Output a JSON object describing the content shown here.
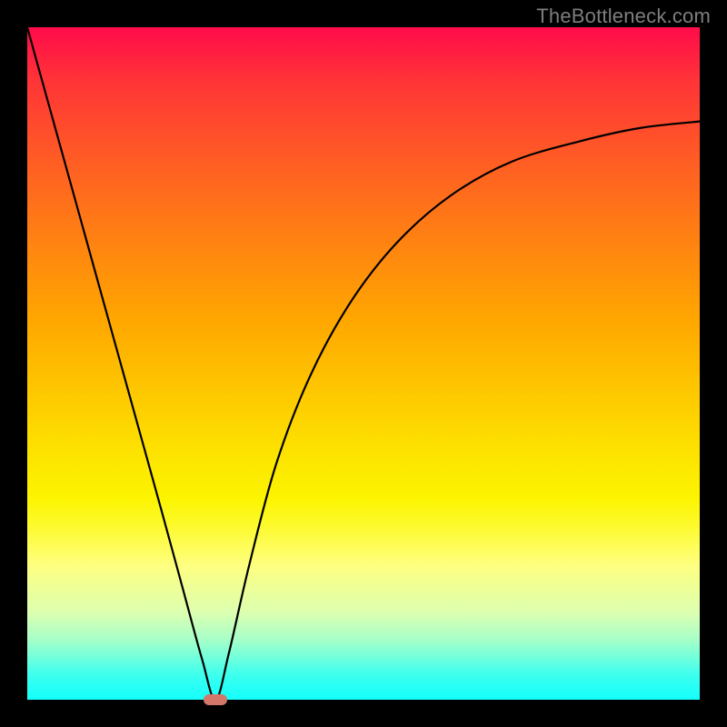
{
  "watermark": "TheBottleneck.com",
  "chart_data": {
    "type": "line",
    "title": "",
    "xlabel": "",
    "ylabel": "",
    "xlim": [
      0,
      1
    ],
    "ylim": [
      0,
      1
    ],
    "grid": false,
    "legend": false,
    "background_gradient": {
      "direction": "vertical",
      "stops": [
        {
          "pos": 0.0,
          "color": "#ff0b4a"
        },
        {
          "pos": 0.5,
          "color": "#ffb400"
        },
        {
          "pos": 0.75,
          "color": "#feff60"
        },
        {
          "pos": 1.0,
          "color": "#15fffb"
        }
      ]
    },
    "series": [
      {
        "name": "bottleneck-curve",
        "color": "#000000",
        "x": [
          0.0,
          0.05,
          0.1,
          0.15,
          0.2,
          0.23,
          0.26,
          0.28,
          0.3,
          0.33,
          0.37,
          0.42,
          0.48,
          0.55,
          0.63,
          0.72,
          0.82,
          0.91,
          1.0
        ],
        "y": [
          1.0,
          0.82,
          0.64,
          0.46,
          0.28,
          0.17,
          0.06,
          0.0,
          0.07,
          0.2,
          0.35,
          0.48,
          0.59,
          0.68,
          0.75,
          0.8,
          0.83,
          0.85,
          0.86
        ]
      }
    ],
    "marker": {
      "name": "optimal-point",
      "x": 0.28,
      "y": 0.0,
      "color": "#d2776a"
    }
  }
}
